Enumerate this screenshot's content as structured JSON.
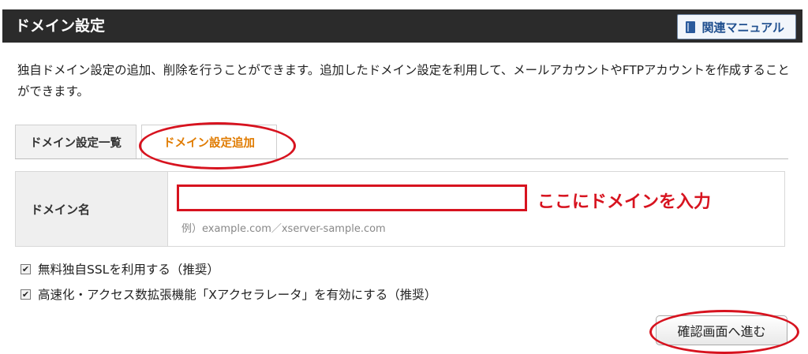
{
  "header": {
    "title": "ドメイン設定",
    "manual_button_label": "関連マニュアル",
    "manual_icon": "book-icon"
  },
  "description": "独自ドメイン設定の追加、削除を行うことができます。追加したドメイン設定を利用して、メールアカウントやFTPアカウントを作成することができます。",
  "tabs": [
    {
      "label": "ドメイン設定一覧",
      "active": false
    },
    {
      "label": "ドメイン設定追加",
      "active": true
    }
  ],
  "form": {
    "label": "ドメイン名",
    "domain_value": "",
    "hint": "例）example.com／xserver-sample.com",
    "annotation": "ここにドメインを入力"
  },
  "options": [
    {
      "label": "無料独自SSLを利用する（推奨）",
      "checked": true
    },
    {
      "label": "高速化・アクセス数拡張機能「Xアクセラレータ」を有効にする（推奨）",
      "checked": true
    }
  ],
  "confirm_button_label": "確認画面へ進む",
  "colors": {
    "header_bg": "#2b2b2b",
    "active_tab_text": "#e07b00",
    "highlight_red": "#d7131f"
  }
}
